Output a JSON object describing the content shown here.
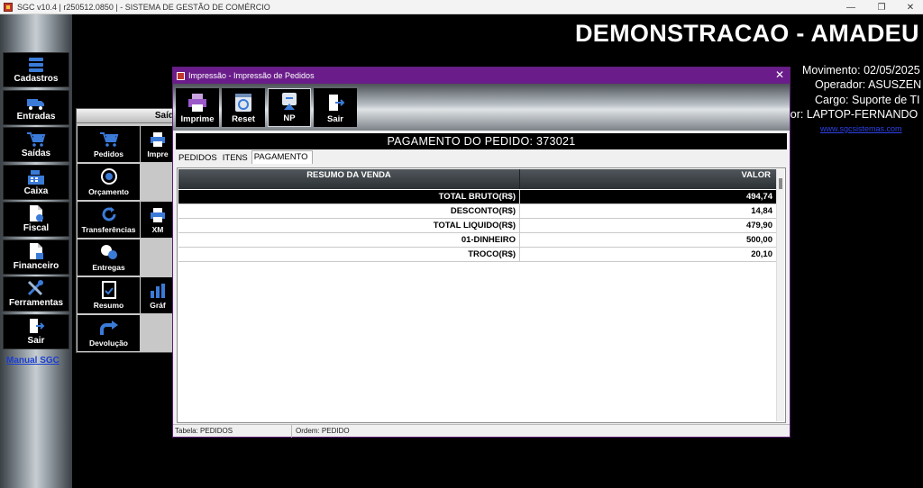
{
  "window": {
    "title": "SGC v10.4 | r250512.0850 | - SISTEMA DE GESTÃO DE COMÉRCIO",
    "minimize": "—",
    "maximize": "❐",
    "close": "✕"
  },
  "sidebar": {
    "items": [
      {
        "label": "Cadastros",
        "icon": "database-icon"
      },
      {
        "label": "Entradas",
        "icon": "truck-icon"
      },
      {
        "label": "Saídas",
        "icon": "cart-icon"
      },
      {
        "label": "Caixa",
        "icon": "cash-register-icon"
      },
      {
        "label": "Fiscal",
        "icon": "document-icon"
      },
      {
        "label": "Financeiro",
        "icon": "finance-document-icon"
      },
      {
        "label": "Ferramentas",
        "icon": "tools-icon"
      },
      {
        "label": "Sair",
        "icon": "exit-door-icon"
      }
    ],
    "manual_link": "Manual SGC"
  },
  "header": {
    "company": "DEMONSTRACAO - AMADEU",
    "movimento": "Movimento: 02/05/2025",
    "operador": "Operador: ASUSZEN",
    "cargo": "Cargo: Suporte de TI",
    "computador": "lor: LAPTOP-FERNANDO",
    "website": "www.sgcsistemas.com"
  },
  "submenu": {
    "title": "Saíd",
    "items": [
      {
        "label": "Pedidos",
        "icon": "cart-icon"
      },
      {
        "label": "Impre",
        "icon": "printer-icon"
      },
      {
        "label": "Orçamento",
        "icon": "budget-icon"
      },
      {
        "label": "Transferências",
        "icon": "refresh-icon"
      },
      {
        "label": "XM",
        "icon": "printer-icon"
      },
      {
        "label": "Entregas",
        "icon": "delivery-icon"
      },
      {
        "label": "Resumo",
        "icon": "summary-icon"
      },
      {
        "label": "Gráf",
        "icon": "chart-icon"
      },
      {
        "label": "Devolução",
        "icon": "return-arrow-icon"
      }
    ]
  },
  "dialog": {
    "title": "Impressão - Impressão de Pedidos",
    "close": "✕",
    "toolbar": [
      {
        "label": "Imprime",
        "icon": "printer-icon"
      },
      {
        "label": "Reset",
        "icon": "reset-icon"
      },
      {
        "label": "NP",
        "icon": "np-icon"
      },
      {
        "label": "Sair",
        "icon": "exit-door-icon"
      }
    ],
    "section_title": "PAGAMENTO DO PEDIDO: 373021",
    "tabs": [
      "PEDIDOS",
      "ITENS",
      "PAGAMENTO"
    ],
    "active_tab": "PAGAMENTO",
    "table": {
      "columns": [
        "RESUMO DA VENDA",
        "VALOR"
      ],
      "rows": [
        {
          "label": "TOTAL BRUTO(R$)",
          "value": "494,74"
        },
        {
          "label": "DESCONTO(R$)",
          "value": "14,84"
        },
        {
          "label": "TOTAL LIQUIDO(R$)",
          "value": "479,90"
        },
        {
          "label": "01-DINHEIRO",
          "value": "500,00"
        },
        {
          "label": "TROCO(R$)",
          "value": "20,10"
        }
      ]
    },
    "status": {
      "tabela": "Tabela: PEDIDOS",
      "ordem": "Ordem: PEDIDO"
    }
  }
}
